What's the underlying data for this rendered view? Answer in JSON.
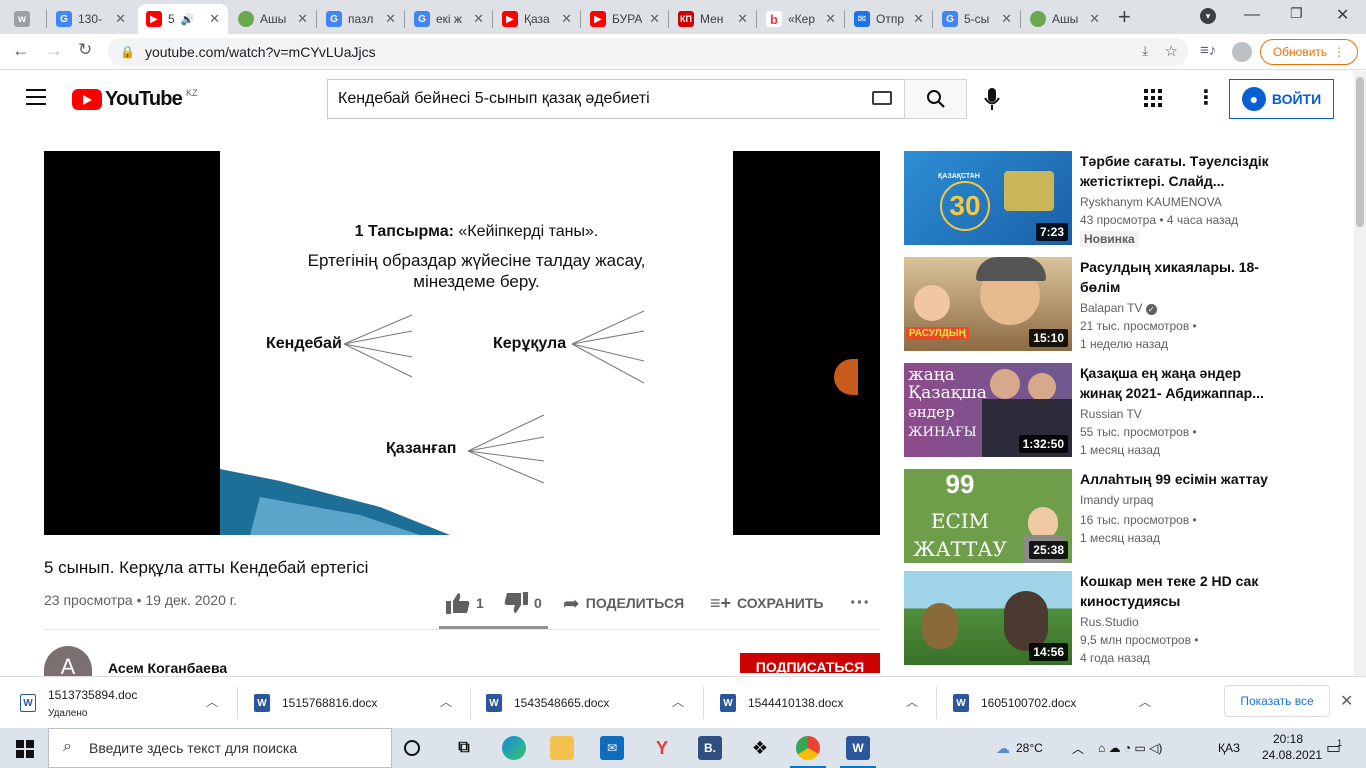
{
  "browser": {
    "tabs": [
      {
        "title": "",
        "icon": "app-icon",
        "color": "#9aa0a6"
      },
      {
        "title": "130-",
        "icon": "google-icon",
        "color": "#4285f4"
      },
      {
        "title": "5",
        "icon": "youtube-icon",
        "color": "#ff0000",
        "active": true
      },
      {
        "title": "Ашы",
        "icon": "globe-icon",
        "color": "#6aa84f"
      },
      {
        "title": "пазл",
        "icon": "google-icon",
        "color": "#4285f4"
      },
      {
        "title": "екі ж",
        "icon": "google-icon",
        "color": "#4285f4"
      },
      {
        "title": "Қаза",
        "icon": "youtube-icon",
        "color": "#ff0000"
      },
      {
        "title": "БУРА",
        "icon": "youtube-icon",
        "color": "#ff0000"
      },
      {
        "title": "Мен",
        "icon": "kp-icon",
        "color": "#d00000"
      },
      {
        "title": "«Кер",
        "icon": "b-icon",
        "color": "#e53935"
      },
      {
        "title": "Отпр",
        "icon": "mail-icon",
        "color": "#1a73e8"
      },
      {
        "title": "5-сы",
        "icon": "google-icon",
        "color": "#4285f4"
      },
      {
        "title": "Ашы",
        "icon": "globe-icon",
        "color": "#6aa84f"
      }
    ],
    "url": "youtube.com/watch?v=mCYvLUaJjcs",
    "update_label": "Обновить"
  },
  "youtube": {
    "logo_text": "YouTube",
    "region": "KZ",
    "search_value": "Кендебай бейнесі 5-сынып қазақ әдебиеті",
    "signin_label": "ВОЙТИ"
  },
  "slide": {
    "task_bold": "1 Тапсырма:",
    "task_rest": " «Кейіпкерді таны».",
    "line1": "Ертегінің образдар жүйесіне талдау жасау,",
    "line2": "мінездеме беру.",
    "char1": "Кендебай",
    "char2": "Керұқула",
    "char3": "Қазанғап"
  },
  "video": {
    "title": "5 сынып. Керқұла атты Кендебай ертегісі",
    "meta": "23 просмотра • 19 дек. 2020 г.",
    "likes": "1",
    "dislikes": "0",
    "share_label": "ПОДЕЛИТЬСЯ",
    "save_label": "СОХРАНИТЬ",
    "channel": "Асем Коганбаева",
    "avatar_letter": "А",
    "subscribe_label": "ПОДПИСАТЬСЯ"
  },
  "recommendations": [
    {
      "title": "Тәрбие сағаты. Тәуелсіздік жетістіктері. Слайд...",
      "channel": "Ryskhanym KAUMENOVA",
      "views": "43 просмотра • 4 часа назад",
      "extra": "Новинка",
      "duration": "7:23"
    },
    {
      "title": "Расулдың хикаялары. 18-бөлім",
      "channel": "Balapan TV",
      "views": "21 тыс. просмотров •",
      "extra": "1 неделю назад",
      "duration": "15:10"
    },
    {
      "title": "Қазақша ең жаңа әндер жинақ 2021- Абдижаппар...",
      "channel": "Russian TV",
      "views": "55 тыс. просмотров •",
      "extra": "1 месяц назад",
      "duration": "1:32:50"
    },
    {
      "title": "Аллаһтың 99 есімін жаттау",
      "channel": "Imandy urpaq",
      "views": "16 тыс. просмотров •",
      "extra": "1 месяц назад",
      "duration": "25:38"
    },
    {
      "title": "Кошкар мен теке 2 HD сак киностудиясы",
      "channel": "Rus.Studio",
      "views": "9,5 млн просмотров •",
      "extra": "4 года назад",
      "duration": "14:56"
    }
  ],
  "thumbs": {
    "t1_number": "30",
    "t1_label": "ҚАЗАҚСТАН",
    "t2_label": "РАСУЛДЫҢ",
    "t3_top": "жаңа",
    "t3_mid": "Қазақша",
    "t3_line3": "әндер",
    "t3_line4": "ЖИНАҒЫ",
    "t4_top": "99",
    "t4_mid": "ЕСІМ",
    "t4_bottom": "ЖАТТАУ"
  },
  "downloads": {
    "items": [
      {
        "name": "1513735894.doc",
        "status": "Удалено"
      },
      {
        "name": "1515768816.docx"
      },
      {
        "name": "1543548665.docx"
      },
      {
        "name": "1544410138.docx"
      },
      {
        "name": "1605100702.docx"
      }
    ],
    "show_all_label": "Показать все"
  },
  "taskbar": {
    "search_placeholder": "Введите здесь текст для поиска",
    "temperature": "28°C",
    "lang": "ҚАЗ",
    "time": "20:18",
    "date": "24.08.2021",
    "notif_count": "1"
  }
}
